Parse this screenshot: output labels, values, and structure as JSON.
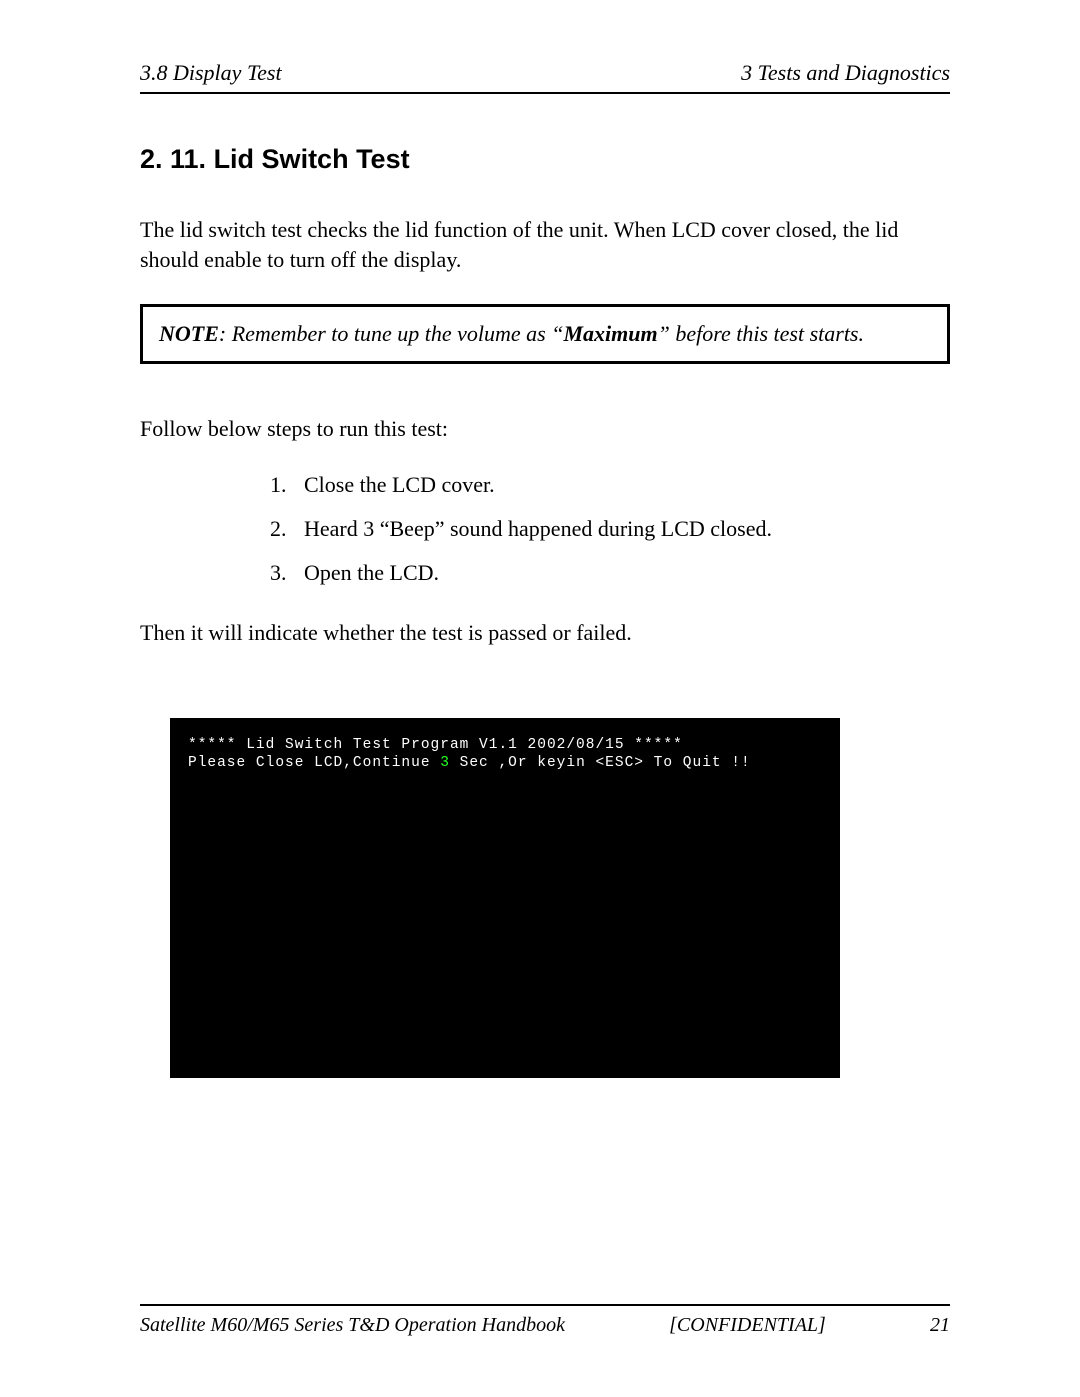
{
  "header": {
    "left": "3.8  Display Test",
    "right": "3  Tests and Diagnostics"
  },
  "section": {
    "title": "2. 11. Lid Switch Test",
    "intro": "The lid switch test checks the lid function of the unit. When LCD cover closed, the lid should enable to turn off the display.",
    "note_label": "NOTE",
    "note_sep": ":  ",
    "note_before": "Remember to tune up the volume as “",
    "note_bold": "Maximum",
    "note_after": "” before this test starts.",
    "follow": "Follow below steps to run this test:",
    "steps": [
      {
        "num": "1.",
        "text": "Close the LCD cover."
      },
      {
        "num": "2.",
        "text": "Heard 3 “Beep” sound happened during LCD closed."
      },
      {
        "num": "3.",
        "text": "Open the LCD."
      }
    ],
    "result": "Then it will indicate whether the test is passed or failed."
  },
  "terminal": {
    "line1": "***** Lid Switch Test Program V1.1 2002/08/15 *****",
    "line2_prefix": "Please Close LCD,Continue ",
    "line2_highlight": "3",
    "line2_suffix": " Sec ,Or keyin <ESC> To Quit !!"
  },
  "footer": {
    "left": "Satellite M60/M65 Series T&D Operation Handbook",
    "center": "[CONFIDENTIAL]",
    "page": "21"
  }
}
